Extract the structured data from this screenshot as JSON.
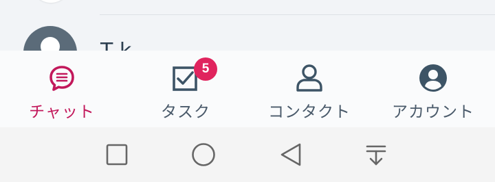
{
  "list_peek": {
    "contact_name_partial": "T  k"
  },
  "tabs": [
    {
      "id": "chat",
      "label": "チャット",
      "icon": "chat-bubble-icon",
      "active": true
    },
    {
      "id": "tasks",
      "label": "タスク",
      "icon": "checkbox-icon",
      "active": false,
      "badge": "5"
    },
    {
      "id": "contacts",
      "label": "コンタクト",
      "icon": "person-outline-icon",
      "active": false
    },
    {
      "id": "account",
      "label": "アカウント",
      "icon": "account-circle-icon",
      "active": false
    }
  ],
  "system_nav": [
    "recent-apps-icon",
    "home-icon",
    "back-icon",
    "notification-shade-icon"
  ],
  "colors": {
    "active": "#c2185b",
    "inactive": "#4a5a6a",
    "badge": "#e0245e",
    "nav_icon": "#666666"
  }
}
